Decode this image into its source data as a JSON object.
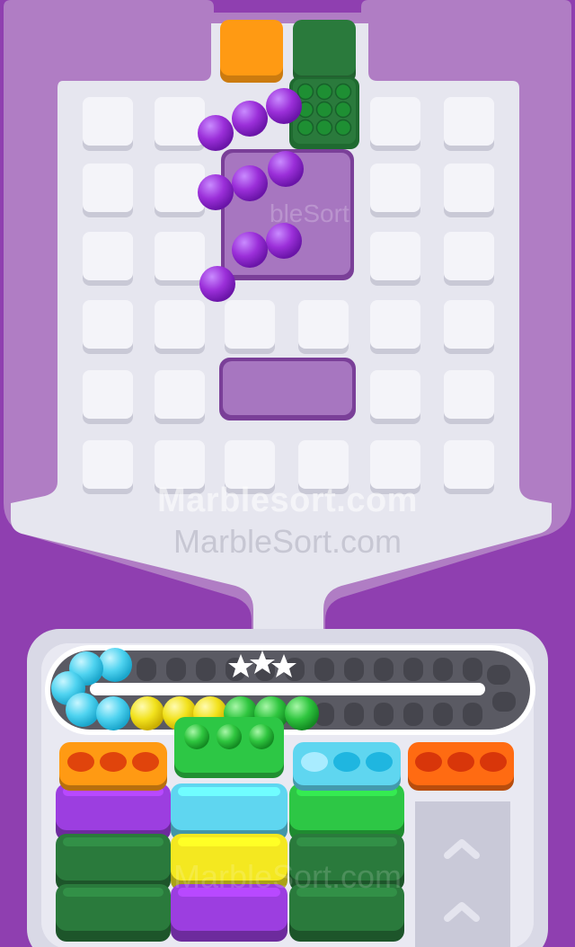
{
  "watermarks": {
    "primary": "Marblesort.com",
    "secondary": "MarbleSort.com",
    "board_overlay": "bleSort",
    "bottom_overlay": "MarbleSort.com"
  },
  "colors": {
    "background": "#8f3fb0",
    "frame": "#b07dc4",
    "board": "#e6e6ef",
    "tile": "#f4f4f9",
    "marble_purple": "#9b2fd9",
    "marble_cyan": "#4fd3f0",
    "marble_yellow": "#f2e21d",
    "marble_green": "#2fc63f",
    "orange": "#ff9a13",
    "dark_green": "#2a7a3c",
    "cyan": "#5fd6f0",
    "yellow": "#f4e820",
    "green": "#2dc745",
    "purple": "#9c3ee0",
    "orange_red": "#ff6b12"
  },
  "dispenser_blocks": [
    "orange",
    "dark_green"
  ],
  "marbles_in_flight": {
    "color": "marble_purple",
    "count": 9
  },
  "conveyor": {
    "stars_icon": "three-stars-icon",
    "marbles": [
      "marble_cyan",
      "marble_cyan",
      "marble_cyan",
      "marble_cyan",
      "marble_cyan",
      "marble_yellow",
      "marble_yellow",
      "marble_yellow",
      "marble_green",
      "marble_green",
      "marble_green"
    ]
  },
  "columns": [
    {
      "top": "orange",
      "stack": [
        "purple",
        "dark_green",
        "dark_green"
      ]
    },
    {
      "top": "green",
      "stack": [
        "cyan",
        "yellow",
        "purple"
      ]
    },
    {
      "top": "cyan",
      "stack": [
        "green",
        "dark_green",
        "dark_green"
      ]
    },
    {
      "top": "orange_red",
      "stack": []
    }
  ]
}
